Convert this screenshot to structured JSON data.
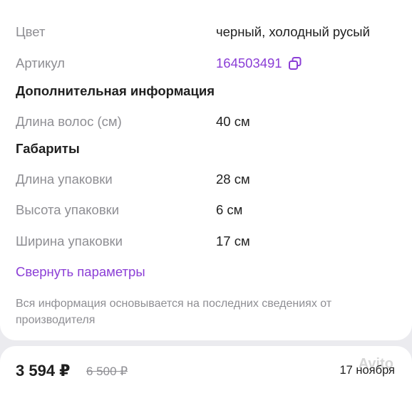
{
  "characteristics": [
    {
      "label": "Цвет",
      "value": "черный, холодный русый"
    },
    {
      "label": "Артикул",
      "value": "164503491"
    }
  ],
  "sections": [
    {
      "title": "Дополнительная информация",
      "rows": [
        {
          "label": "Длина волос (см)",
          "value": "40 см"
        }
      ]
    },
    {
      "title": "Габариты",
      "rows": [
        {
          "label": "Длина упаковки",
          "value": "28 см"
        },
        {
          "label": "Высота упаковки",
          "value": "6 см"
        },
        {
          "label": "Ширина упаковки",
          "value": "17 см"
        }
      ]
    }
  ],
  "collapse_label": "Свернуть параметры",
  "disclaimer": "Вся информация основывается на последних сведениях от производителя",
  "bottom_bar": {
    "price": "3 594 ₽",
    "old_price": "6 500 ₽",
    "delivery_date": "17 ноября"
  },
  "colors": {
    "accent": "#8b3ed6",
    "muted": "#8e8e93",
    "background": "#ebebef"
  },
  "icons": {
    "copy": "copy-icon"
  }
}
